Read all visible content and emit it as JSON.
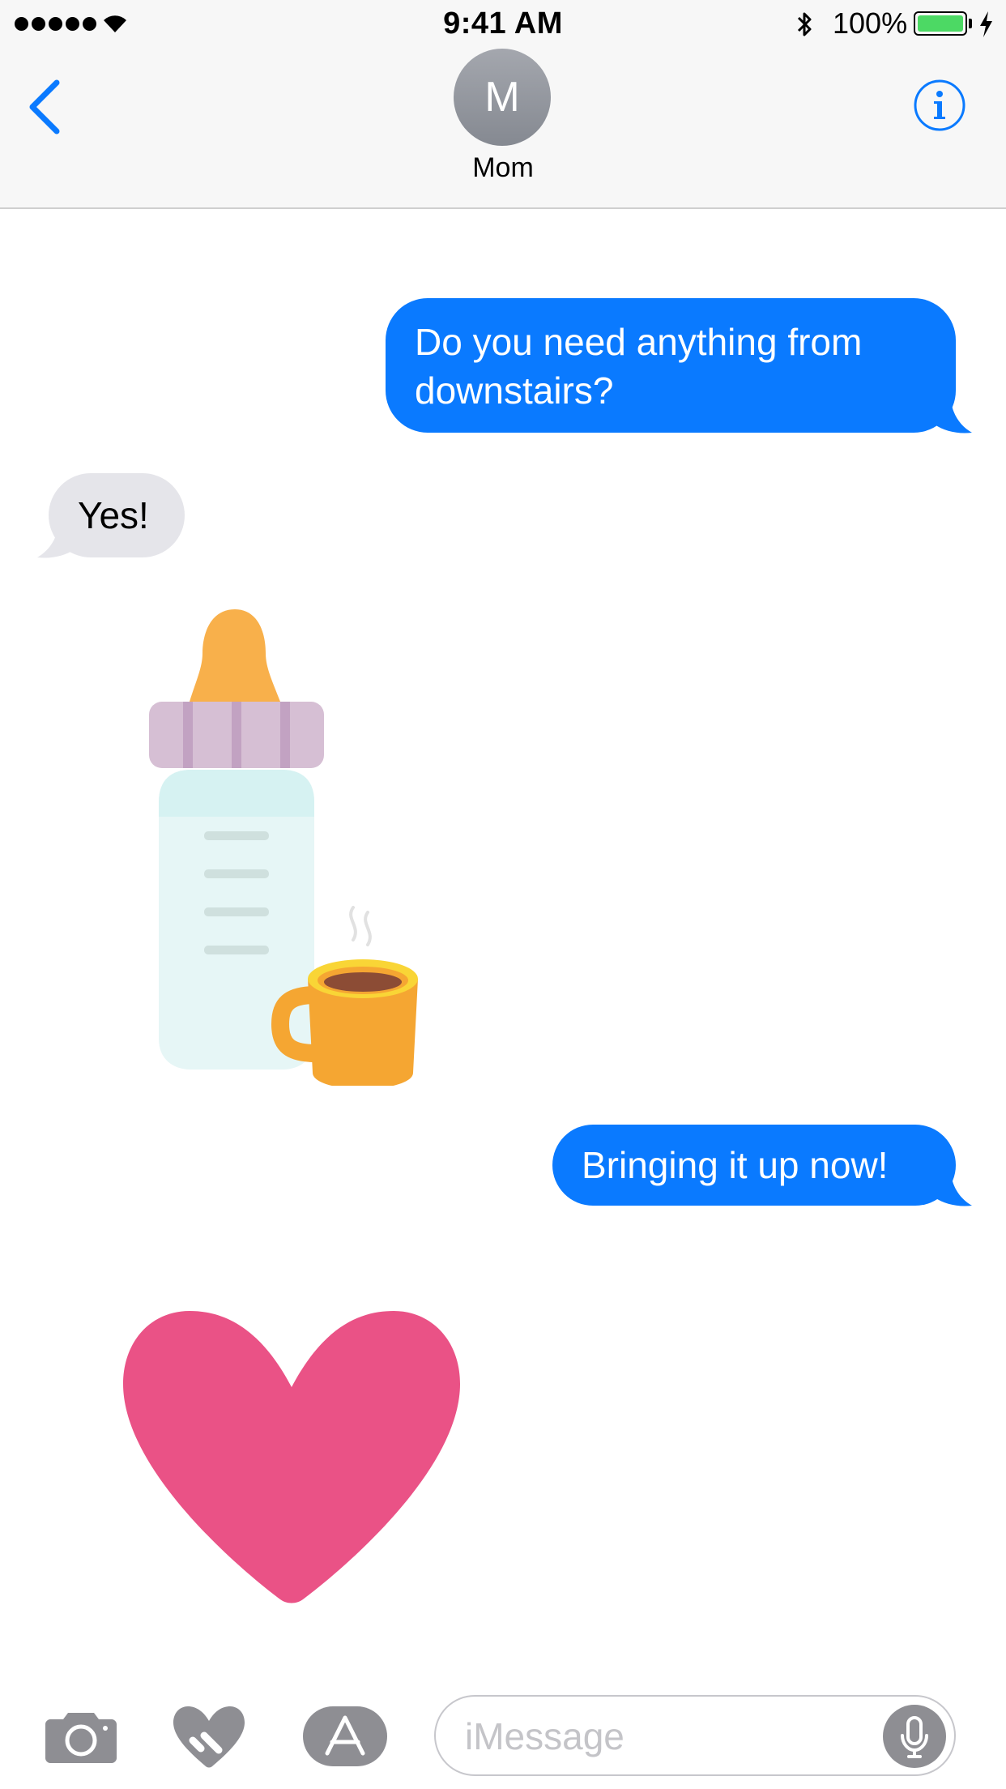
{
  "status_bar": {
    "time": "9:41 AM",
    "battery_percent": "100%",
    "battery_level": 1.0,
    "signal_bars": 5,
    "icons": [
      "signal-dots-icon",
      "wifi-icon",
      "bluetooth-icon",
      "battery-icon",
      "charging-bolt-icon"
    ]
  },
  "header": {
    "back_icon": "chevron-left-icon",
    "avatar_initial": "M",
    "contact_name": "Mom",
    "info_icon": "info-icon"
  },
  "messages": [
    {
      "direction": "outgoing",
      "text": "Do you need anything from downstairs?"
    },
    {
      "direction": "incoming",
      "text": "Yes!"
    },
    {
      "direction": "incoming",
      "sticker": "baby-bottle-and-coffee-mug-sticker"
    },
    {
      "direction": "outgoing",
      "text": "Bringing it up now!"
    },
    {
      "direction": "incoming",
      "sticker": "pink-heart-sticker"
    }
  ],
  "input_bar": {
    "placeholder": "iMessage",
    "value": "",
    "buttons": [
      "camera-icon",
      "digital-touch-heart-icon",
      "app-store-icon",
      "microphone-icon"
    ]
  },
  "colors": {
    "outgoing_bubble": "#0a7aff",
    "incoming_bubble": "#e5e5ea",
    "accent": "#0a7aff",
    "battery": "#4cd964",
    "heart": "#ea5286"
  }
}
